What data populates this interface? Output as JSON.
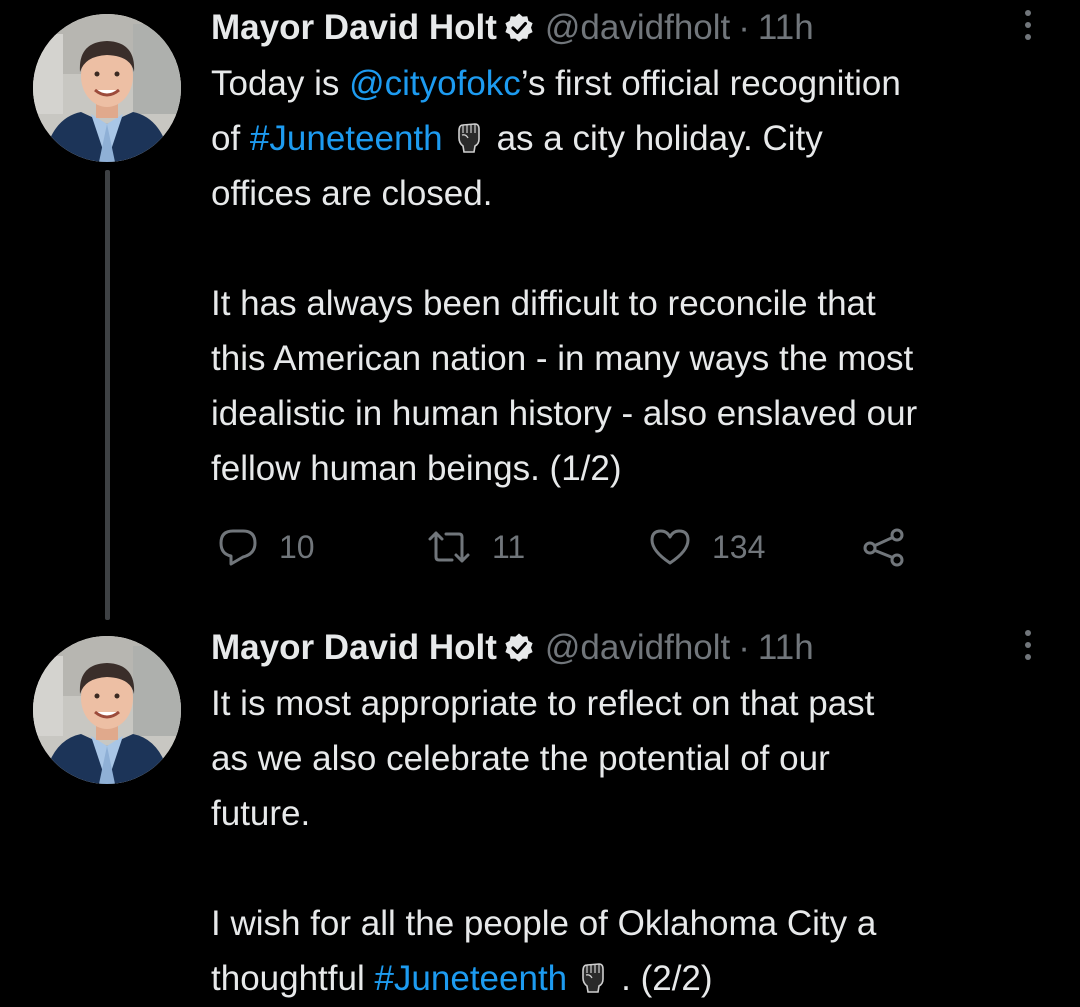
{
  "tweets": [
    {
      "author": {
        "display_name": "Mayor David Holt",
        "handle": "@davidfholt",
        "separator": "·",
        "time": "11h"
      },
      "lines": [
        [
          "Today is ",
          "@cityofokc",
          "’s first official recognition"
        ],
        [
          "of ",
          "#Juneteenth",
          "as a city holiday.  City"
        ],
        [
          "offices are closed."
        ],
        [],
        [
          "It has always been difficult to reconcile that"
        ],
        [
          "this American nation - in many ways the most"
        ],
        [
          "idealistic in human history - also enslaved our"
        ],
        [
          "fellow human beings.   (1/2)"
        ]
      ],
      "stats": {
        "replies": "10",
        "retweets": "11",
        "likes": "134"
      }
    },
    {
      "author": {
        "display_name": "Mayor David Holt",
        "handle": "@davidfholt",
        "separator": "·",
        "time": "11h"
      },
      "lines": [
        [
          "It is most appropriate to reflect on that past"
        ],
        [
          "as we also celebrate the potential of our"
        ],
        [
          "future."
        ],
        [],
        [
          "I wish for all the people of Oklahoma City a"
        ],
        [
          "thoughtful ",
          "#Juneteenth",
          ".   (2/2)"
        ]
      ]
    }
  ],
  "icons": {
    "verified": "verified-badge-icon",
    "more": "more-vertical-icon",
    "reply": "reply-icon",
    "retweet": "retweet-icon",
    "like": "heart-icon",
    "share": "share-icon",
    "fist": "raised-fist-emoji-icon"
  },
  "colors": {
    "background": "#000000",
    "text": "#e7e9ea",
    "secondary": "#71767b",
    "link": "#1d9bf0",
    "thread_line": "#3e4144"
  }
}
